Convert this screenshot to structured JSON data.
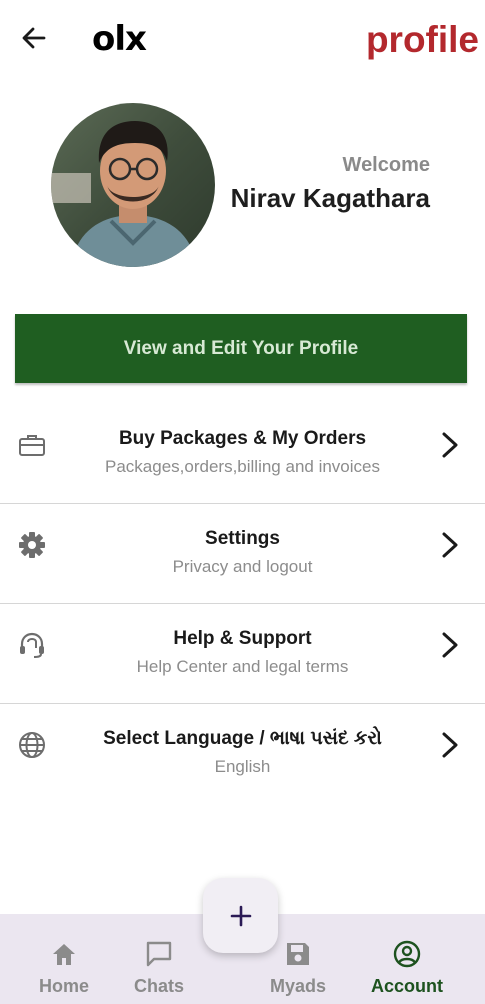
{
  "header": {
    "logo_text": "olx",
    "page_tag": "profile"
  },
  "profile": {
    "welcome": "Welcome",
    "name": "Nirav Kagathara",
    "edit_button": "View and Edit Your Profile"
  },
  "menu": [
    {
      "title": "Buy Packages & My Orders",
      "subtitle": "Packages,orders,billing and invoices",
      "icon": "briefcase-icon"
    },
    {
      "title": "Settings",
      "subtitle": "Privacy and logout",
      "icon": "gear-icon"
    },
    {
      "title": "Help & Support",
      "subtitle": "Help Center and legal terms",
      "icon": "headset-icon"
    },
    {
      "title": "Select Language / ભાષા પસંદ કરો",
      "subtitle": "English",
      "icon": "globe-icon"
    }
  ],
  "bottom_nav": [
    {
      "label": "Home",
      "icon": "home-icon"
    },
    {
      "label": "Chats",
      "icon": "chat-icon"
    },
    {
      "label": "Myads",
      "icon": "save-icon"
    },
    {
      "label": "Account",
      "icon": "account-icon",
      "active": true
    }
  ],
  "fab": {
    "symbol": "+"
  },
  "colors": {
    "accent_green": "#1f5e21",
    "brand_red": "#b3282d",
    "nav_background": "#ebe6f0"
  }
}
